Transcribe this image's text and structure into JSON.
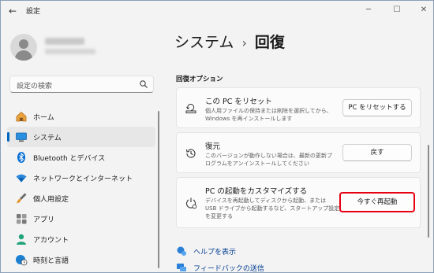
{
  "app": {
    "title": "設定",
    "back_icon": "back-arrow-icon",
    "window_controls": [
      "minimize-icon",
      "maximize-icon",
      "close-icon"
    ]
  },
  "search": {
    "placeholder": "設定の検索",
    "icon": "search-icon"
  },
  "nav": {
    "items": [
      {
        "label": "ホーム",
        "icon": "home-icon",
        "active": false
      },
      {
        "label": "システム",
        "icon": "monitor-icon",
        "active": true
      },
      {
        "label": "Bluetooth とデバイス",
        "icon": "bluetooth-icon",
        "active": false
      },
      {
        "label": "ネットワークとインターネット",
        "icon": "wifi-icon",
        "active": false
      },
      {
        "label": "個人用設定",
        "icon": "brush-icon",
        "active": false
      },
      {
        "label": "アプリ",
        "icon": "apps-icon",
        "active": false
      },
      {
        "label": "アカウント",
        "icon": "account-icon",
        "active": false
      },
      {
        "label": "時刻と言語",
        "icon": "globe-clock-icon",
        "active": false
      }
    ]
  },
  "breadcrumb": {
    "parent": "システム",
    "separator": "›",
    "current": "回復"
  },
  "section": {
    "title": "回復オプション"
  },
  "cards": [
    {
      "title": "この PC をリセット",
      "desc": "個人用ファイルの保持または削除を選択してから、\nWindows を再インストールします",
      "button": "PC をリセットする",
      "icon": "reset-pc-icon"
    },
    {
      "title": "復元",
      "desc": "このバージョンが動作しない場合は、最新の更新プ\nログラムをアンインストールしてください",
      "button": "戻す",
      "icon": "history-icon"
    },
    {
      "title": "PC の起動をカスタマイズする",
      "desc": "デバイスを再起動してディスクから起動、または\nUSB ドライブから起動するなど、スタートアップ設定\nを変更する",
      "button": "今すぐ再起動",
      "icon": "advanced-startup-icon",
      "highlight_color": "#e60012"
    }
  ],
  "links": [
    {
      "label": "ヘルプを表示",
      "icon": "help-icon"
    },
    {
      "label": "フィードバックの送信",
      "icon": "feedback-icon"
    }
  ],
  "colors": {
    "accent": "#0067c0",
    "highlight": "#e60012",
    "link": "#003e92"
  }
}
